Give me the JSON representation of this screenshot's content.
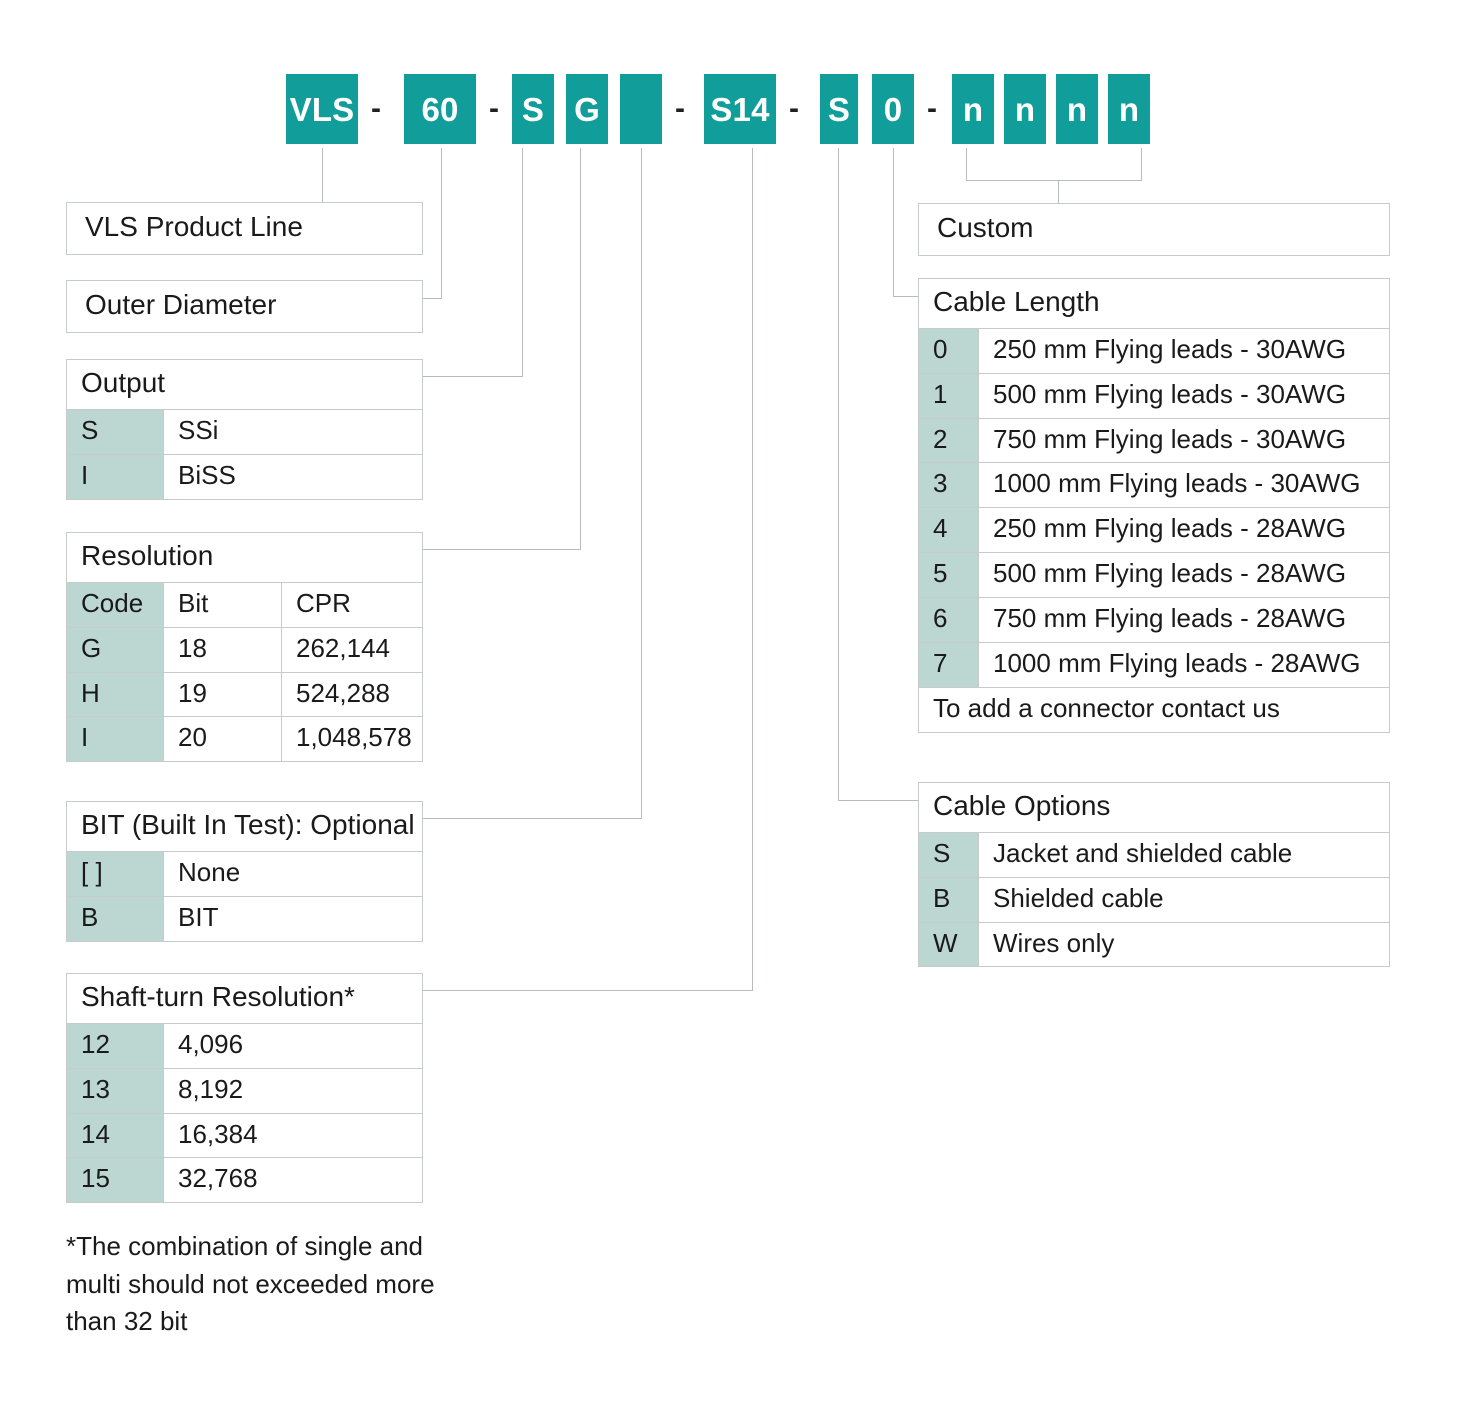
{
  "colors": {
    "block_teal": "#119e9a",
    "code_cell_fill": "#bcd6d2",
    "border_gray": "#c8cbcc",
    "leader_gray": "#b9bcbd"
  },
  "part_number": {
    "segments": [
      {
        "type": "block",
        "label": "VLS"
      },
      {
        "type": "dash",
        "label": "-"
      },
      {
        "type": "block",
        "label": "60"
      },
      {
        "type": "dash",
        "label": "-"
      },
      {
        "type": "block",
        "label": "S"
      },
      {
        "type": "block",
        "label": "G"
      },
      {
        "type": "block",
        "label": ""
      },
      {
        "type": "dash",
        "label": "-"
      },
      {
        "type": "block",
        "label": "S14"
      },
      {
        "type": "dash",
        "label": "-"
      },
      {
        "type": "block",
        "label": "S"
      },
      {
        "type": "block",
        "label": "0"
      },
      {
        "type": "dash",
        "label": "-"
      },
      {
        "type": "block",
        "label": "n"
      },
      {
        "type": "block",
        "label": "n"
      },
      {
        "type": "block",
        "label": "n"
      },
      {
        "type": "block",
        "label": "n"
      }
    ]
  },
  "product_line": {
    "title": "VLS  Product Line"
  },
  "outer_diameter": {
    "title": "Outer Diameter"
  },
  "output": {
    "title": "Output",
    "rows": [
      {
        "code": "S",
        "desc": "SSi"
      },
      {
        "code": "I",
        "desc": "BiSS"
      }
    ]
  },
  "resolution": {
    "title": "Resolution",
    "headers": {
      "code": "Code",
      "bit": "Bit",
      "cpr": "CPR"
    },
    "rows": [
      {
        "code": "G",
        "bit": "18",
        "cpr": "262,144"
      },
      {
        "code": "H",
        "bit": "19",
        "cpr": "524,288"
      },
      {
        "code": "I",
        "bit": "20",
        "cpr": "1,048,578"
      }
    ]
  },
  "bit_test": {
    "title": "BIT (Built In Test): Optional",
    "rows": [
      {
        "code": "[ ]",
        "desc": "None"
      },
      {
        "code": "B",
        "desc": "BIT"
      }
    ]
  },
  "shaft_turn": {
    "title": "Shaft-turn Resolution*",
    "rows": [
      {
        "code": "12",
        "desc": "4,096"
      },
      {
        "code": "13",
        "desc": "8,192"
      },
      {
        "code": "14",
        "desc": "16,384"
      },
      {
        "code": "15",
        "desc": "32,768"
      }
    ]
  },
  "footnote": {
    "text": "*The combination of single and multi should not exceeded more than 32 bit"
  },
  "custom": {
    "title": "Custom"
  },
  "cable_length": {
    "title": "Cable Length",
    "rows": [
      {
        "code": "0",
        "desc": "250 mm Flying leads - 30AWG"
      },
      {
        "code": "1",
        "desc": "500 mm Flying leads - 30AWG"
      },
      {
        "code": "2",
        "desc": "750 mm Flying leads - 30AWG"
      },
      {
        "code": "3",
        "desc": "1000 mm Flying leads - 30AWG"
      },
      {
        "code": "4",
        "desc": "250 mm Flying leads - 28AWG"
      },
      {
        "code": "5",
        "desc": "500 mm Flying leads - 28AWG"
      },
      {
        "code": "6",
        "desc": "750 mm Flying leads - 28AWG"
      },
      {
        "code": "7",
        "desc": "1000 mm Flying leads - 28AWG"
      }
    ],
    "note": "To add a connector contact us"
  },
  "cable_options": {
    "title": "Cable Options",
    "rows": [
      {
        "code": "S",
        "desc": "Jacket and shielded cable"
      },
      {
        "code": "B",
        "desc": "Shielded cable"
      },
      {
        "code": "W",
        "desc": "Wires only"
      }
    ]
  }
}
